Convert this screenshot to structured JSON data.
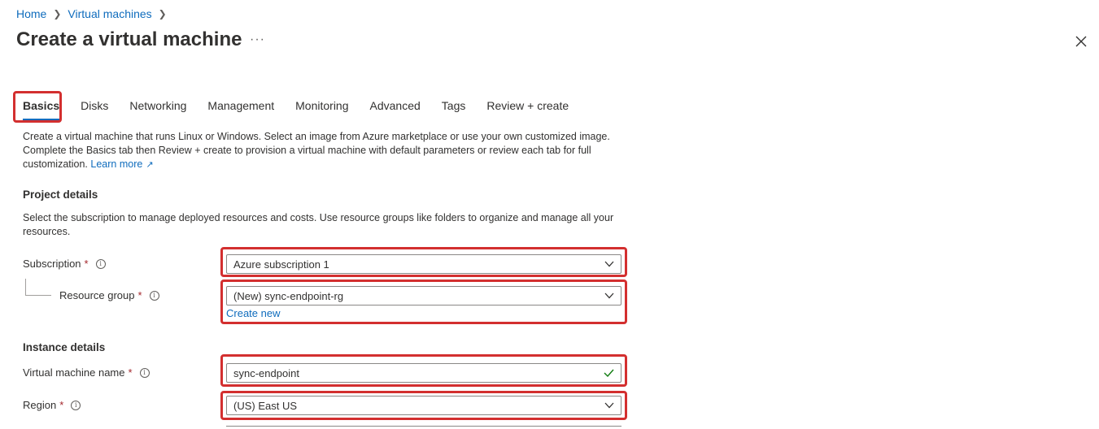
{
  "breadcrumb": {
    "home": "Home",
    "virtual_machines": "Virtual machines"
  },
  "page": {
    "title": "Create a virtual machine",
    "more": "···"
  },
  "tabs": [
    {
      "label": "Basics"
    },
    {
      "label": "Disks"
    },
    {
      "label": "Networking"
    },
    {
      "label": "Management"
    },
    {
      "label": "Monitoring"
    },
    {
      "label": "Advanced"
    },
    {
      "label": "Tags"
    },
    {
      "label": "Review + create"
    }
  ],
  "intro": {
    "text": "Create a virtual machine that runs Linux or Windows. Select an image from Azure marketplace or use your own customized image. Complete the Basics tab then Review + create to provision a virtual machine with default parameters or review each tab for full customization.",
    "learn_more": "Learn more"
  },
  "project_details": {
    "heading": "Project details",
    "description": "Select the subscription to manage deployed resources and costs. Use resource groups like folders to organize and manage all your resources.",
    "subscription": {
      "label": "Subscription",
      "required": "*",
      "value": "Azure subscription 1"
    },
    "resource_group": {
      "label": "Resource group",
      "required": "*",
      "value": "(New) sync-endpoint-rg",
      "create_new": "Create new"
    }
  },
  "instance_details": {
    "heading": "Instance details",
    "vm_name": {
      "label": "Virtual machine name",
      "required": "*",
      "value": "sync-endpoint"
    },
    "region": {
      "label": "Region",
      "required": "*",
      "value": "(US) East US"
    }
  },
  "colors": {
    "accent": "#0f6cbd",
    "highlight": "#d32f2f",
    "required": "#a4262c",
    "valid": "#107c10"
  },
  "icons": {
    "close": "close-icon",
    "info": "info-icon",
    "chevron": "chevron-down-icon",
    "check": "checkmark-icon",
    "external": "external-link-icon"
  }
}
